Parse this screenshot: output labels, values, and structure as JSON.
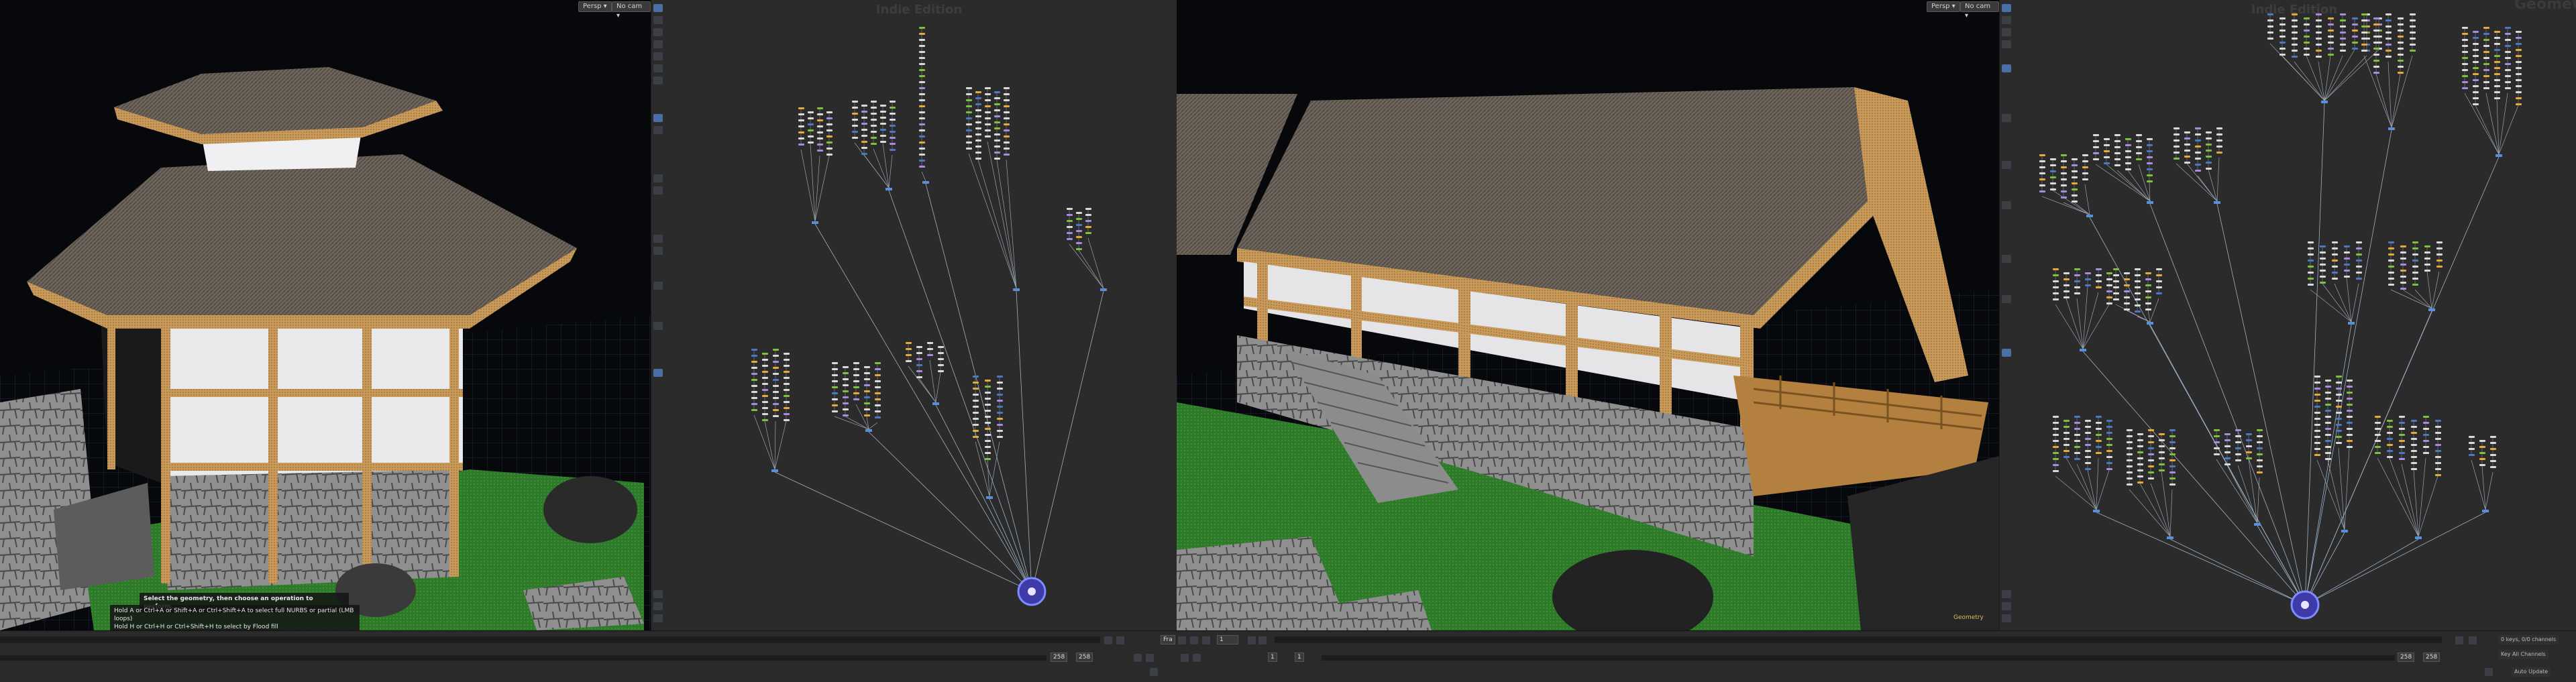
{
  "left_viewport": {
    "camera_menu": "Persp ▾",
    "cam_menu": "No cam ▾",
    "hint_title": "Select the geometry, then choose an operation to perform.",
    "hint_line1": "Hold A or Ctrl+A or Shift+A or Ctrl+Shift+A to select full NURBS or partial (LMB loops)",
    "hint_line2": "Hold H or Ctrl+H or Ctrl+Shift+H to select by Flood fill"
  },
  "right_viewport": {
    "camera_menu": "Persp ▾",
    "cam_menu": "No cam ▾",
    "corner_label": "Geometry"
  },
  "left_network": {
    "title": "Indie Edition"
  },
  "right_network": {
    "title": "Indie Edition",
    "watermark": "Geometr"
  },
  "timeline": {
    "frame_current": "1",
    "frame_start": "1",
    "frame_start2": "1",
    "range_end_left": "258",
    "range_end_left2": "258",
    "range_end_right": "258",
    "range_end_right2": "258"
  },
  "keys_panel": {
    "item1": "0 keys, 0/0 channels",
    "item2": "Key All Channels",
    "item3": "Auto Update"
  }
}
